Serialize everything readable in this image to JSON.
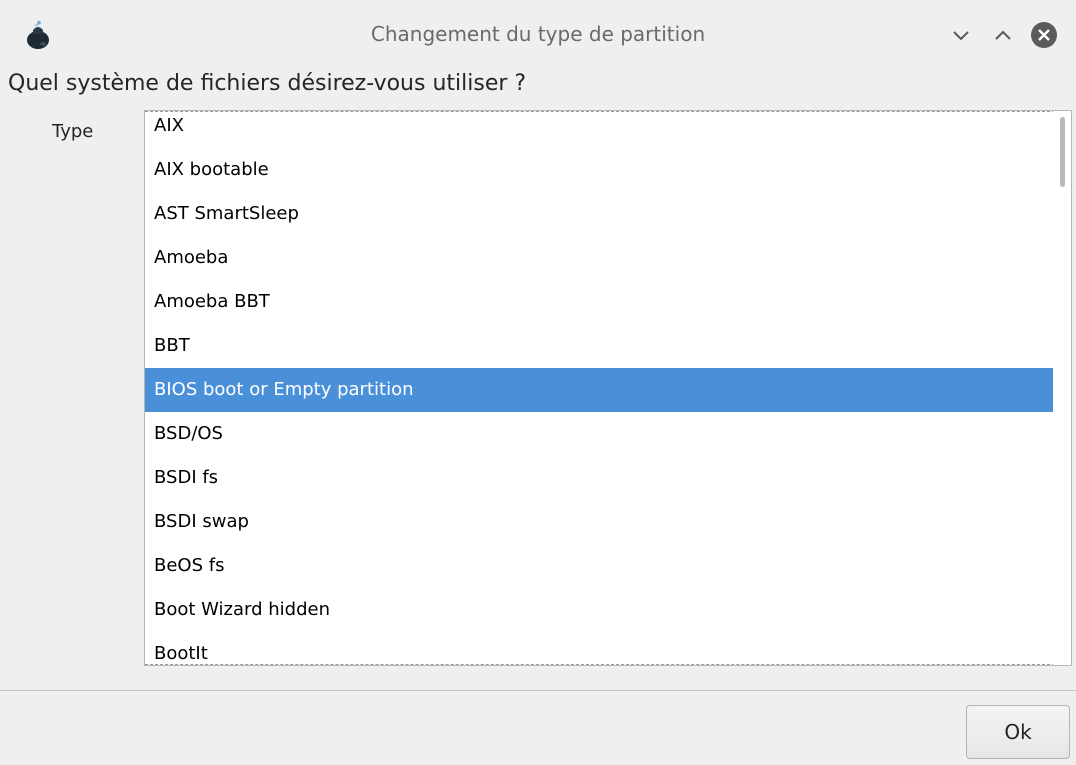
{
  "window": {
    "title": "Changement du type de partition",
    "app_icon": "drakdisk-icon",
    "controls": {
      "minimize_icon": "chevron-down-icon",
      "maximize_icon": "chevron-up-icon",
      "close_icon": "close-circle-icon"
    }
  },
  "dialog": {
    "question": "Quel système de fichiers désirez-vous utiliser ?",
    "type_label": "Type",
    "list": {
      "items": [
        "AIX",
        "AIX bootable",
        "AST SmartSleep",
        "Amoeba",
        "Amoeba BBT",
        "BBT",
        "BIOS boot or Empty partition",
        "BSD/OS",
        "BSDI fs",
        "BSDI swap",
        "BeOS fs",
        "Boot Wizard hidden",
        "BootIt"
      ],
      "selected_index": 6
    },
    "ok_label": "Ok"
  },
  "colors": {
    "selection": "#4a90d9",
    "background": "#efefef",
    "list_background": "#ffffff"
  }
}
